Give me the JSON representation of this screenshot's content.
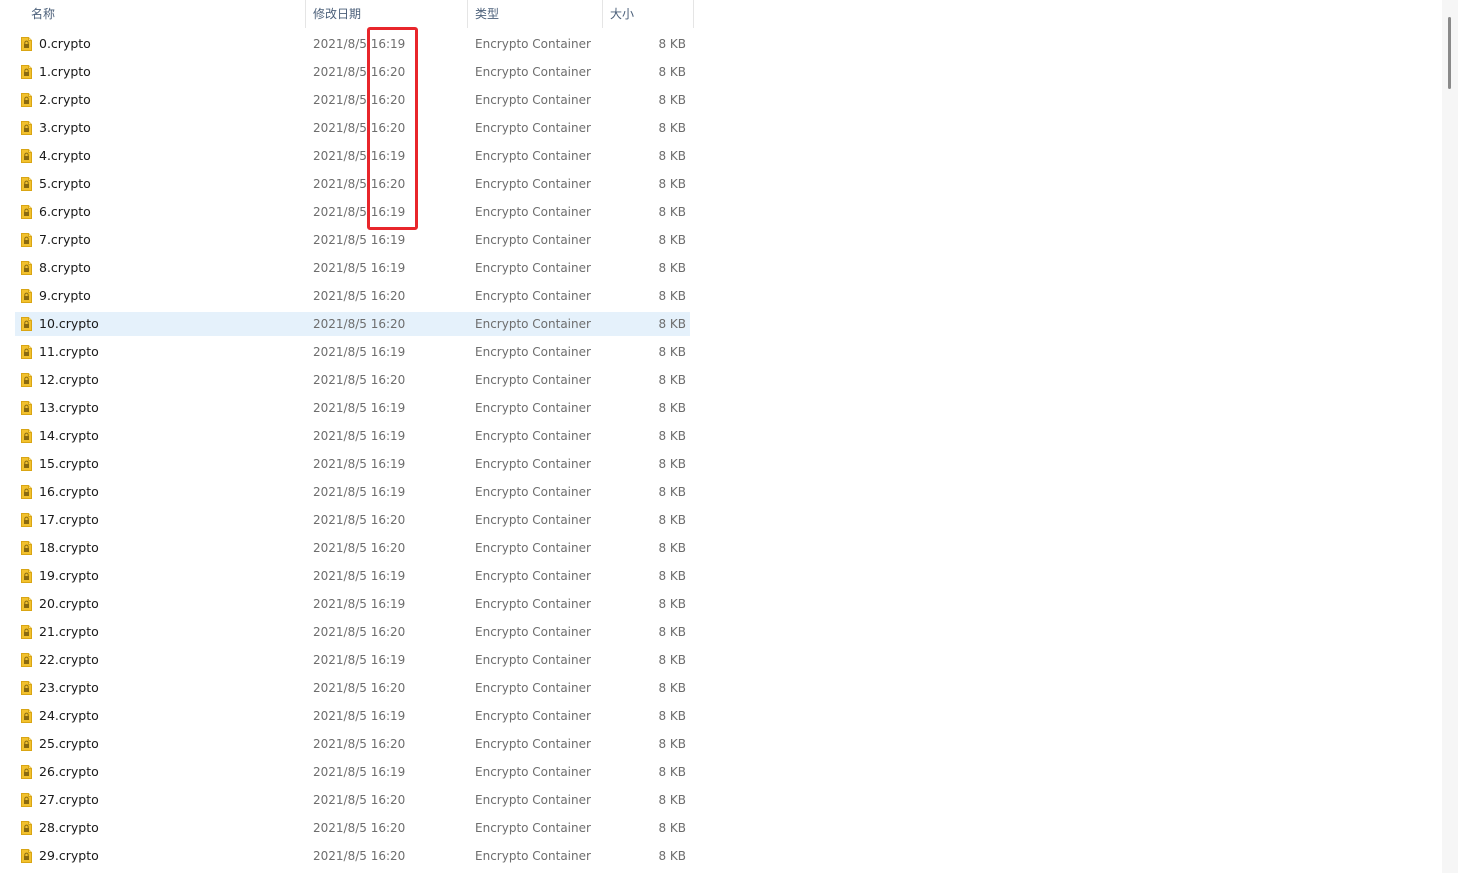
{
  "header": {
    "columns": [
      {
        "label": "名称"
      },
      {
        "label": "修改日期"
      },
      {
        "label": "类型"
      },
      {
        "label": "大小"
      }
    ],
    "sort_icon": "chevron-up-icon"
  },
  "files": [
    {
      "name": "0.crypto",
      "date": "2021/8/5 16:19",
      "type": "Encrypto Container",
      "size": "8 KB"
    },
    {
      "name": "1.crypto",
      "date": "2021/8/5 16:20",
      "type": "Encrypto Container",
      "size": "8 KB"
    },
    {
      "name": "2.crypto",
      "date": "2021/8/5 16:20",
      "type": "Encrypto Container",
      "size": "8 KB"
    },
    {
      "name": "3.crypto",
      "date": "2021/8/5 16:20",
      "type": "Encrypto Container",
      "size": "8 KB"
    },
    {
      "name": "4.crypto",
      "date": "2021/8/5 16:19",
      "type": "Encrypto Container",
      "size": "8 KB"
    },
    {
      "name": "5.crypto",
      "date": "2021/8/5 16:20",
      "type": "Encrypto Container",
      "size": "8 KB"
    },
    {
      "name": "6.crypto",
      "date": "2021/8/5 16:19",
      "type": "Encrypto Container",
      "size": "8 KB"
    },
    {
      "name": "7.crypto",
      "date": "2021/8/5 16:19",
      "type": "Encrypto Container",
      "size": "8 KB"
    },
    {
      "name": "8.crypto",
      "date": "2021/8/5 16:19",
      "type": "Encrypto Container",
      "size": "8 KB"
    },
    {
      "name": "9.crypto",
      "date": "2021/8/5 16:20",
      "type": "Encrypto Container",
      "size": "8 KB"
    },
    {
      "name": "10.crypto",
      "date": "2021/8/5 16:20",
      "type": "Encrypto Container",
      "size": "8 KB",
      "selected": true
    },
    {
      "name": "11.crypto",
      "date": "2021/8/5 16:19",
      "type": "Encrypto Container",
      "size": "8 KB"
    },
    {
      "name": "12.crypto",
      "date": "2021/8/5 16:20",
      "type": "Encrypto Container",
      "size": "8 KB"
    },
    {
      "name": "13.crypto",
      "date": "2021/8/5 16:19",
      "type": "Encrypto Container",
      "size": "8 KB"
    },
    {
      "name": "14.crypto",
      "date": "2021/8/5 16:19",
      "type": "Encrypto Container",
      "size": "8 KB"
    },
    {
      "name": "15.crypto",
      "date": "2021/8/5 16:19",
      "type": "Encrypto Container",
      "size": "8 KB"
    },
    {
      "name": "16.crypto",
      "date": "2021/8/5 16:19",
      "type": "Encrypto Container",
      "size": "8 KB"
    },
    {
      "name": "17.crypto",
      "date": "2021/8/5 16:20",
      "type": "Encrypto Container",
      "size": "8 KB"
    },
    {
      "name": "18.crypto",
      "date": "2021/8/5 16:20",
      "type": "Encrypto Container",
      "size": "8 KB"
    },
    {
      "name": "19.crypto",
      "date": "2021/8/5 16:19",
      "type": "Encrypto Container",
      "size": "8 KB"
    },
    {
      "name": "20.crypto",
      "date": "2021/8/5 16:19",
      "type": "Encrypto Container",
      "size": "8 KB"
    },
    {
      "name": "21.crypto",
      "date": "2021/8/5 16:20",
      "type": "Encrypto Container",
      "size": "8 KB"
    },
    {
      "name": "22.crypto",
      "date": "2021/8/5 16:19",
      "type": "Encrypto Container",
      "size": "8 KB"
    },
    {
      "name": "23.crypto",
      "date": "2021/8/5 16:20",
      "type": "Encrypto Container",
      "size": "8 KB"
    },
    {
      "name": "24.crypto",
      "date": "2021/8/5 16:19",
      "type": "Encrypto Container",
      "size": "8 KB"
    },
    {
      "name": "25.crypto",
      "date": "2021/8/5 16:20",
      "type": "Encrypto Container",
      "size": "8 KB"
    },
    {
      "name": "26.crypto",
      "date": "2021/8/5 16:19",
      "type": "Encrypto Container",
      "size": "8 KB"
    },
    {
      "name": "27.crypto",
      "date": "2021/8/5 16:20",
      "type": "Encrypto Container",
      "size": "8 KB"
    },
    {
      "name": "28.crypto",
      "date": "2021/8/5 16:20",
      "type": "Encrypto Container",
      "size": "8 KB"
    },
    {
      "name": "29.crypto",
      "date": "2021/8/5 16:20",
      "type": "Encrypto Container",
      "size": "8 KB"
    }
  ],
  "file_icon": "crypto-file-icon",
  "colors": {
    "selection": "#e5f1fb",
    "highlight_box": "#e8262b",
    "header_text": "#4c607a",
    "icon_yellow": "#f2c12e"
  }
}
